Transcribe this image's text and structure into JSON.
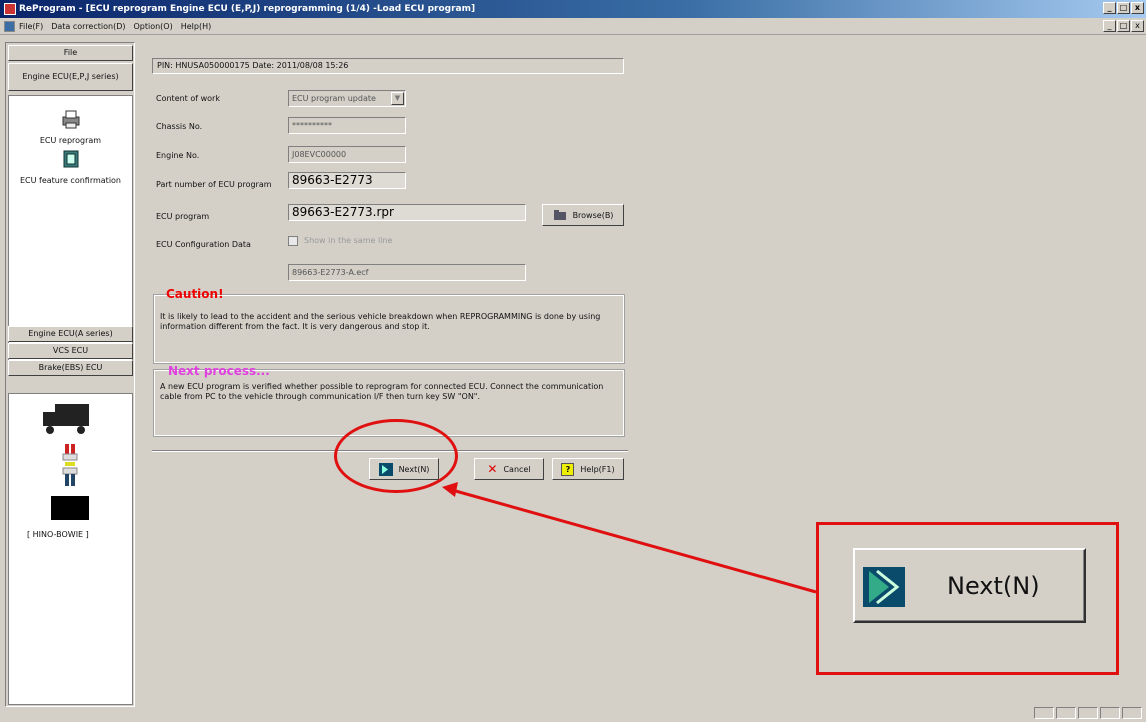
{
  "window": {
    "title": "ReProgram - [ECU reprogram Engine ECU (E,P,J) reprogramming (1/4) -Load ECU program]",
    "buttons": [
      "_",
      "□",
      "x"
    ]
  },
  "menu": {
    "items": [
      "File(F)",
      "Data correction(D)",
      "Option(O)",
      "Help(H)"
    ]
  },
  "sidebar": {
    "top_buttons": [
      "File",
      "Engine ECU(E,P,J series)"
    ],
    "items": [
      {
        "label": "ECU reprogram",
        "icon": "printer-icon"
      },
      {
        "label": "ECU feature confirmation",
        "icon": "notebook-icon"
      }
    ],
    "bottom_buttons": [
      "Engine ECU(A series)",
      "VCS ECU",
      "Brake(EBS) ECU"
    ],
    "device_label": "[ HINO-BOWIE ]"
  },
  "form": {
    "pin_date": "PIN: HNUSA050000175  Date: 2011/08/08 15:26",
    "fields": [
      {
        "label": "Content of work",
        "value": "ECU program update"
      },
      {
        "label": "Chassis No.",
        "value": "**********"
      },
      {
        "label": "Engine No.",
        "value": "J08EVC00000"
      },
      {
        "label": "Part number of ECU program",
        "value": "89663-E2773"
      },
      {
        "label": "ECU program",
        "value": "89663-E2773.rpr"
      },
      {
        "label": "ECU Configuration Data",
        "value": "89663-E2773-A.ecf"
      }
    ],
    "browse_label": "Browse(B)",
    "checkbox_label": "Show in the same line",
    "caution": {
      "title": "Caution!",
      "text": "It is likely to lead to the accident and the serious vehicle breakdown when REPROGRAMMING is done by using information different from the fact. It is very dangerous and stop it."
    },
    "next_process": {
      "title": "Next process...",
      "text": "A new ECU program is verified whether possible to reprogram for connected ECU. Connect the communication cable from PC to the vehicle through communication I/F then turn key SW \"ON\"."
    }
  },
  "buttons": {
    "next": "Next(N)",
    "cancel": "Cancel",
    "help": "Help(F1)"
  },
  "callout": {
    "label": "Next(N)"
  }
}
